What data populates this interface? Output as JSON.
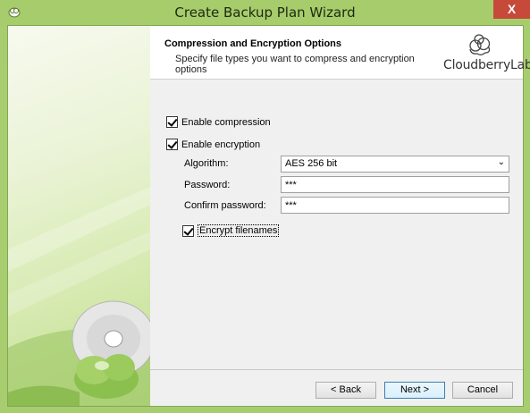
{
  "window": {
    "title": "Create Backup Plan Wizard",
    "close_glyph": "X",
    "app_icon": "cloudberry-app-icon",
    "accent_color": "#a8cd6f"
  },
  "header": {
    "title": "Compression and Encryption Options",
    "subtitle": "Specify file types you want to compress and encryption options",
    "logo_text": "CloudberryLab"
  },
  "options": {
    "compression": {
      "label": "Enable compression",
      "checked": true
    },
    "encryption": {
      "label": "Enable encryption",
      "checked": true
    },
    "algorithm": {
      "label": "Algorithm:",
      "value": "AES 256 bit"
    },
    "password": {
      "label": "Password:",
      "value": "***"
    },
    "confirm_password": {
      "label": "Confirm password:",
      "value": "***"
    },
    "encrypt_filenames": {
      "label": "Encrypt filenames",
      "checked": true
    }
  },
  "buttons": {
    "back": "< Back",
    "next": "Next >",
    "cancel": "Cancel"
  }
}
